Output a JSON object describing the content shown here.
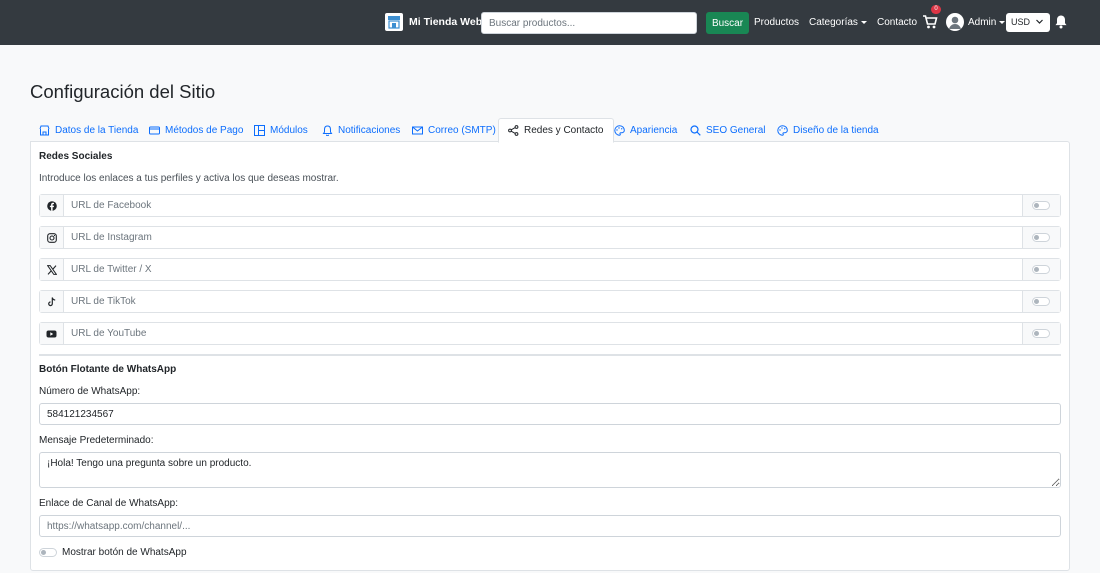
{
  "navbar": {
    "brand": "Mi Tienda Web",
    "search_placeholder": "Buscar productos...",
    "search_button": "Buscar",
    "links": {
      "products": "Productos",
      "categories": "Categorías",
      "contact": "Contacto"
    },
    "cart_count": "0",
    "user": "Admin",
    "currency": "USD"
  },
  "page": {
    "title": "Configuración del Sitio"
  },
  "tabs": [
    {
      "label": "Datos de la Tienda",
      "icon": "store-icon",
      "active": false
    },
    {
      "label": "Métodos de Pago",
      "icon": "credit-card-icon",
      "active": false
    },
    {
      "label": "Módulos",
      "icon": "modules-icon",
      "active": false
    },
    {
      "label": "Notificaciones",
      "icon": "bell-icon",
      "active": false
    },
    {
      "label": "Correo (SMTP)",
      "icon": "envelope-icon",
      "active": false
    },
    {
      "label": "Redes y Contacto",
      "icon": "share-icon",
      "active": true
    },
    {
      "label": "Apariencia",
      "icon": "palette-icon",
      "active": false
    },
    {
      "label": "SEO General",
      "icon": "search-icon",
      "active": false
    },
    {
      "label": "Diseño de la tienda",
      "icon": "palette-icon",
      "active": false
    }
  ],
  "social": {
    "title": "Redes Sociales",
    "help": "Introduce los enlaces a tus perfiles y activa los que deseas mostrar.",
    "rows": [
      {
        "icon": "facebook-icon",
        "placeholder": "URL de Facebook",
        "enabled": false
      },
      {
        "icon": "instagram-icon",
        "placeholder": "URL de Instagram",
        "enabled": false
      },
      {
        "icon": "x-twitter-icon",
        "placeholder": "URL de Twitter / X",
        "enabled": false
      },
      {
        "icon": "tiktok-icon",
        "placeholder": "URL de TikTok",
        "enabled": false
      },
      {
        "icon": "youtube-icon",
        "placeholder": "URL de YouTube",
        "enabled": false
      }
    ]
  },
  "whatsapp": {
    "title": "Botón Flotante de WhatsApp",
    "number_label": "Número de WhatsApp:",
    "number_value": "584121234567",
    "message_label": "Mensaje Predeterminado:",
    "message_value": "¡Hola! Tengo una pregunta sobre un producto.",
    "channel_label": "Enlace de Canal de WhatsApp:",
    "channel_placeholder": "https://whatsapp.com/channel/...",
    "show_label": "Mostrar botón de WhatsApp",
    "show_enabled": false
  },
  "colors": {
    "navbar_bg": "#343a40",
    "search_button": "#198754",
    "tab_link": "#0d6efd",
    "badge": "#dc3545"
  }
}
